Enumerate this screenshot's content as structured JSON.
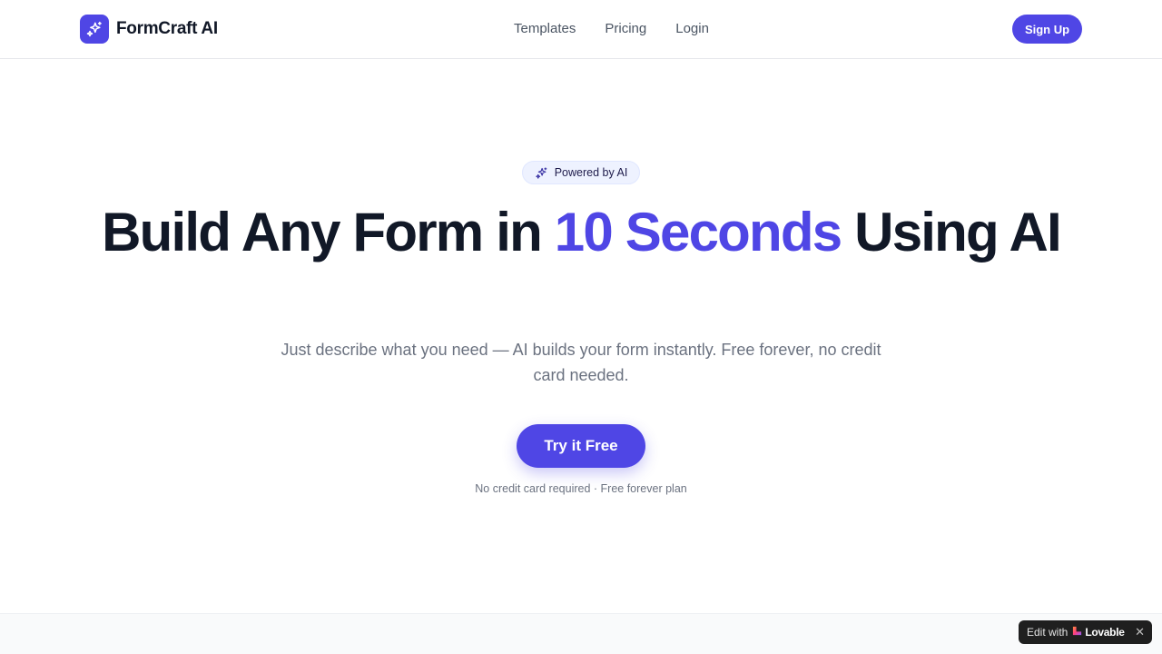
{
  "brand": {
    "name": "FormCraft AI",
    "logo_icon": "sparkles-icon",
    "accent_color": "#4f46e5"
  },
  "nav": {
    "links": [
      "Templates",
      "Pricing",
      "Login"
    ],
    "signup_label": "Sign Up"
  },
  "hero": {
    "badge": {
      "icon": "sparkles-icon",
      "label": "Powered by AI"
    },
    "headline": {
      "part1": "Build Any Form in ",
      "highlight": "10 Seconds",
      "part2": " Using AI"
    },
    "subtitle": "Just describe what you need — AI builds your form instantly. Free forever, no credit card needed.",
    "cta_label": "Try it Free",
    "note": "No credit card required · Free forever plan"
  },
  "lovable_badge": {
    "prefix": "Edit with",
    "brand": "Lovable",
    "close_glyph": "✕"
  }
}
